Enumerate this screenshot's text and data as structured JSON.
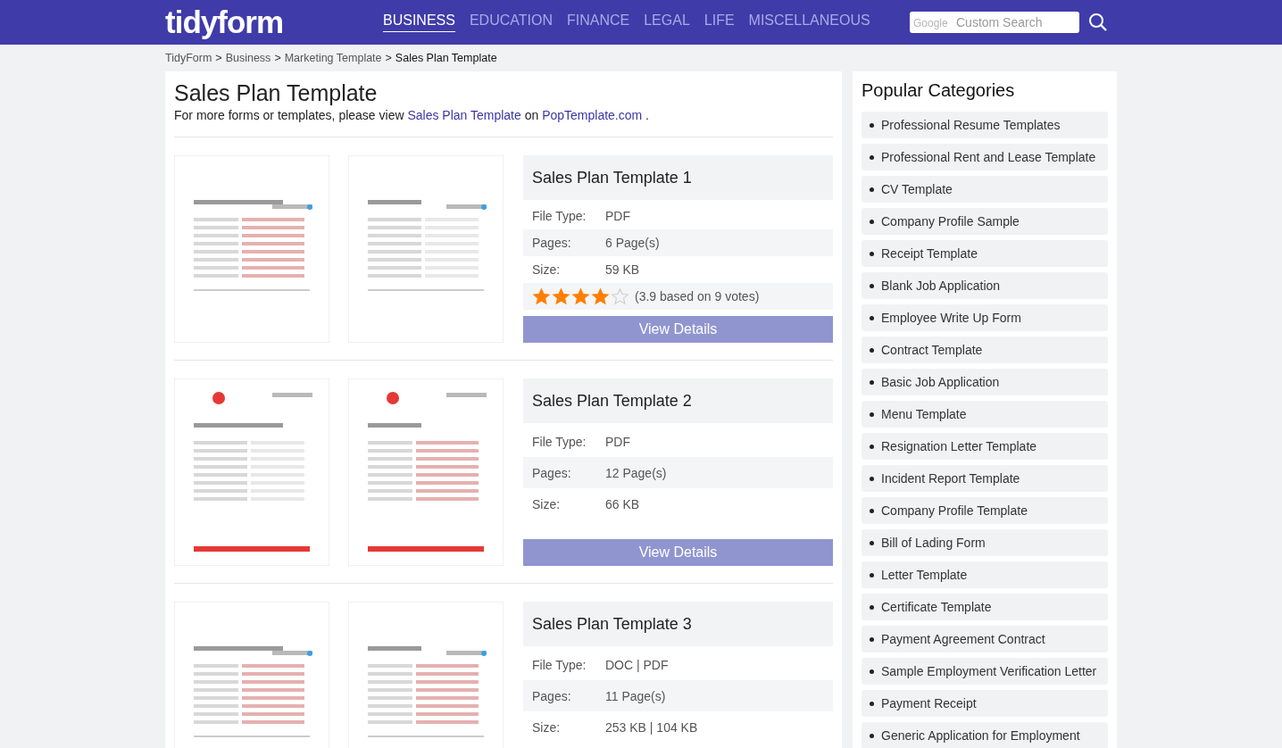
{
  "header": {
    "logo": "tidyform",
    "nav": [
      {
        "label": "BUSINESS",
        "selected": true
      },
      {
        "label": "EDUCATION",
        "selected": false
      },
      {
        "label": "FINANCE",
        "selected": false
      },
      {
        "label": "LEGAL",
        "selected": false
      },
      {
        "label": "LIFE",
        "selected": false
      },
      {
        "label": "MISCELLANEOUS",
        "selected": false
      }
    ],
    "search": {
      "brand": "Google",
      "placeholder": "Custom Search"
    }
  },
  "breadcrumb": [
    {
      "label": "TidyForm",
      "kind": "link"
    },
    {
      "label": ">",
      "kind": "sep"
    },
    {
      "label": "Business",
      "kind": "link"
    },
    {
      "label": ">",
      "kind": "sep"
    },
    {
      "label": "Marketing Template",
      "kind": "link"
    },
    {
      "label": ">",
      "kind": "sep"
    },
    {
      "label": "Sales Plan Template",
      "kind": "current"
    }
  ],
  "page": {
    "title": "Sales Plan Template",
    "intro": [
      {
        "text": "For more forms or templates, please view",
        "kind": "text"
      },
      {
        "text": "Sales Plan Template",
        "kind": "link"
      },
      {
        "text": "on",
        "kind": "text"
      },
      {
        "text": "PopTemplate.com",
        "kind": "link"
      },
      {
        "text": ".",
        "kind": "text"
      }
    ]
  },
  "items": [
    {
      "title": "Sales Plan Template 1",
      "fields": [
        {
          "label": "File Type:",
          "value": "PDF"
        },
        {
          "label": "Pages:",
          "value": "6 Page(s)"
        },
        {
          "label": "Size:",
          "value": "59 KB"
        }
      ],
      "rating": {
        "stars": 4,
        "text": "(3.9 based on 9 votes)"
      },
      "button": "View Details"
    },
    {
      "title": "Sales Plan Template 2",
      "fields": [
        {
          "label": "File Type:",
          "value": "PDF"
        },
        {
          "label": "Pages:",
          "value": "12 Page(s)"
        },
        {
          "label": "Size:",
          "value": "66 KB"
        }
      ],
      "button": "View Details"
    },
    {
      "title": "Sales Plan Template 3",
      "fields": [
        {
          "label": "File Type:",
          "value": "DOC | PDF"
        },
        {
          "label": "Pages:",
          "value": "11 Page(s)"
        },
        {
          "label": "Size:",
          "value": "253 KB | 104 KB"
        }
      ]
    }
  ],
  "sidebar": {
    "title": "Popular Categories",
    "items": [
      "Professional Resume Templates",
      "Professional Rent and Lease Template",
      "CV Template",
      "Company Profile Sample",
      "Receipt Template",
      "Blank Job Application",
      "Employee Write Up Form",
      "Contract Template",
      "Basic Job Application",
      "Menu Template",
      "Resignation Letter Template",
      "Incident Report Template",
      "Company Profile Template",
      "Bill of Lading Form",
      "Letter Template",
      "Certificate Template",
      "Payment Agreement Contract",
      "Sample Employment Verification Letter",
      "Payment Receipt",
      "Generic Application for Employment"
    ]
  }
}
